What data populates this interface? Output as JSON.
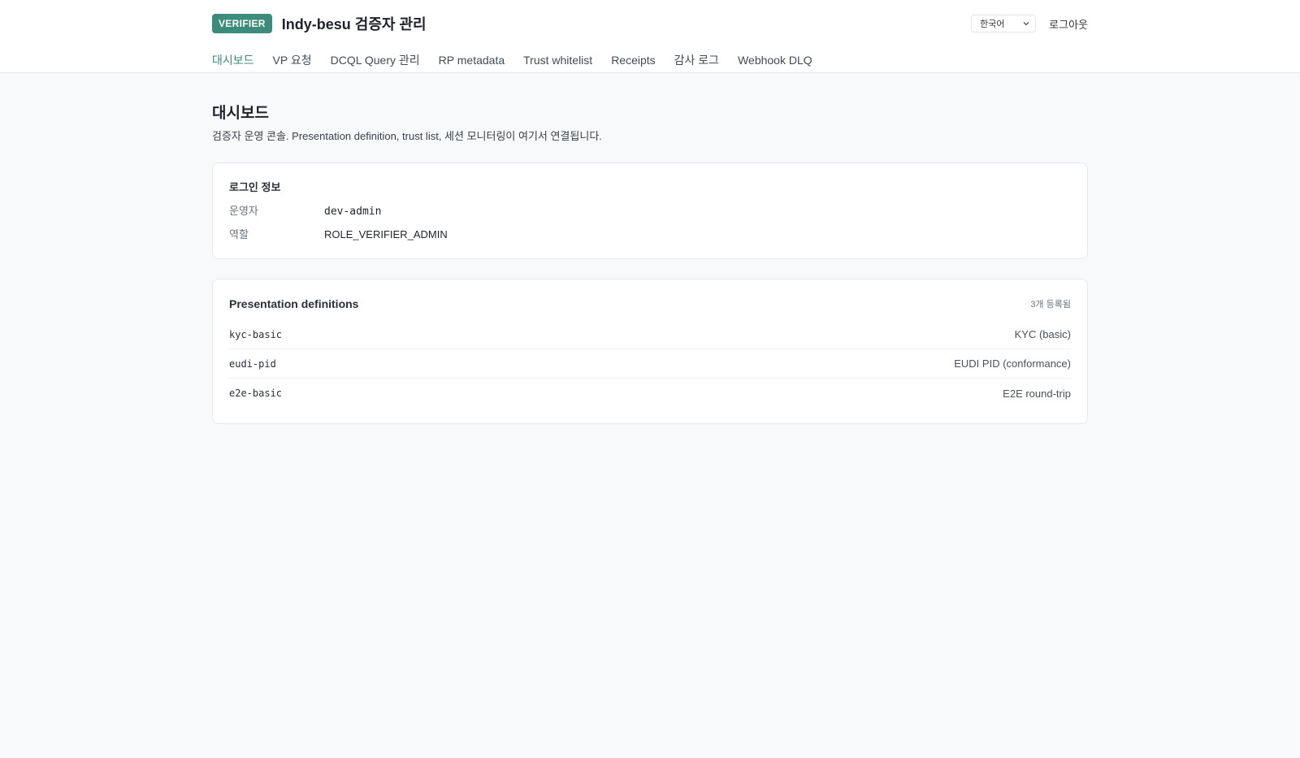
{
  "header": {
    "badge": "VERIFIER",
    "title": "Indy-besu 검증자 관리",
    "language": "한국어",
    "logout": "로그아웃"
  },
  "nav": {
    "items": [
      {
        "label": "대시보드",
        "active": true
      },
      {
        "label": "VP 요청"
      },
      {
        "label": "DCQL Query 관리"
      },
      {
        "label": "RP metadata"
      },
      {
        "label": "Trust whitelist"
      },
      {
        "label": "Receipts"
      },
      {
        "label": "감사 로그"
      },
      {
        "label": "Webhook DLQ"
      }
    ]
  },
  "page": {
    "title": "대시보드",
    "description": "검증자 운영 콘솔. Presentation definition, trust list, 세션 모니터링이 여기서 연결됩니다."
  },
  "login_card": {
    "title": "로그인 정보",
    "rows": [
      {
        "label": "운영자",
        "value": "dev-admin"
      },
      {
        "label": "역할",
        "value": "ROLE_VERIFIER_ADMIN"
      }
    ]
  },
  "definitions_card": {
    "title": "Presentation definitions",
    "count": "3개 등록됨",
    "items": [
      {
        "id": "kyc-basic",
        "name": "KYC (basic)"
      },
      {
        "id": "eudi-pid",
        "name": "EUDI PID (conformance)"
      },
      {
        "id": "e2e-basic",
        "name": "E2E round-trip"
      }
    ]
  },
  "colors": {
    "accent": "#3d8b7a",
    "background": "#f8f9fa"
  }
}
